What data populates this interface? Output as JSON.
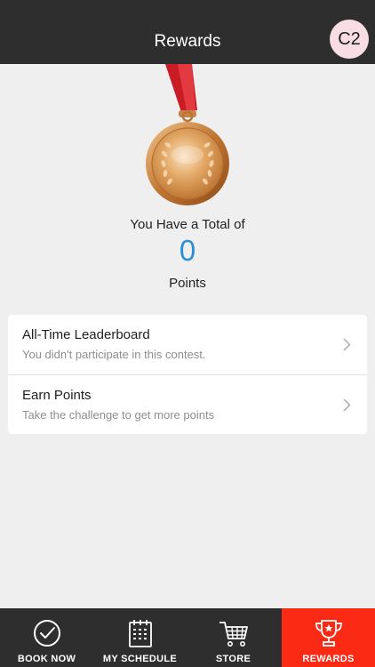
{
  "header": {
    "title": "Rewards",
    "avatar_text": "C2"
  },
  "summary": {
    "total_label": "You Have a Total of",
    "points_value": "0",
    "points_label": "Points"
  },
  "menu": {
    "items": [
      {
        "title": "All-Time Leaderboard",
        "subtitle": "You didn't participate in this contest."
      },
      {
        "title": "Earn Points",
        "subtitle": "Take the challenge to get more points"
      }
    ]
  },
  "tabbar": {
    "tabs": [
      {
        "label": "BOOK NOW",
        "icon": "check-circle-icon"
      },
      {
        "label": "MY SCHEDULE",
        "icon": "calendar-icon"
      },
      {
        "label": "STORE",
        "icon": "cart-icon"
      },
      {
        "label": "REWARDS",
        "icon": "trophy-icon"
      }
    ],
    "active": "REWARDS"
  },
  "colors": {
    "header_bg": "#2e2e2e",
    "accent_blue": "#2c8ed6",
    "active_tab": "#fb2a14",
    "medal_ribbon": "#d8202a",
    "medal_gold": "#d4954e"
  }
}
